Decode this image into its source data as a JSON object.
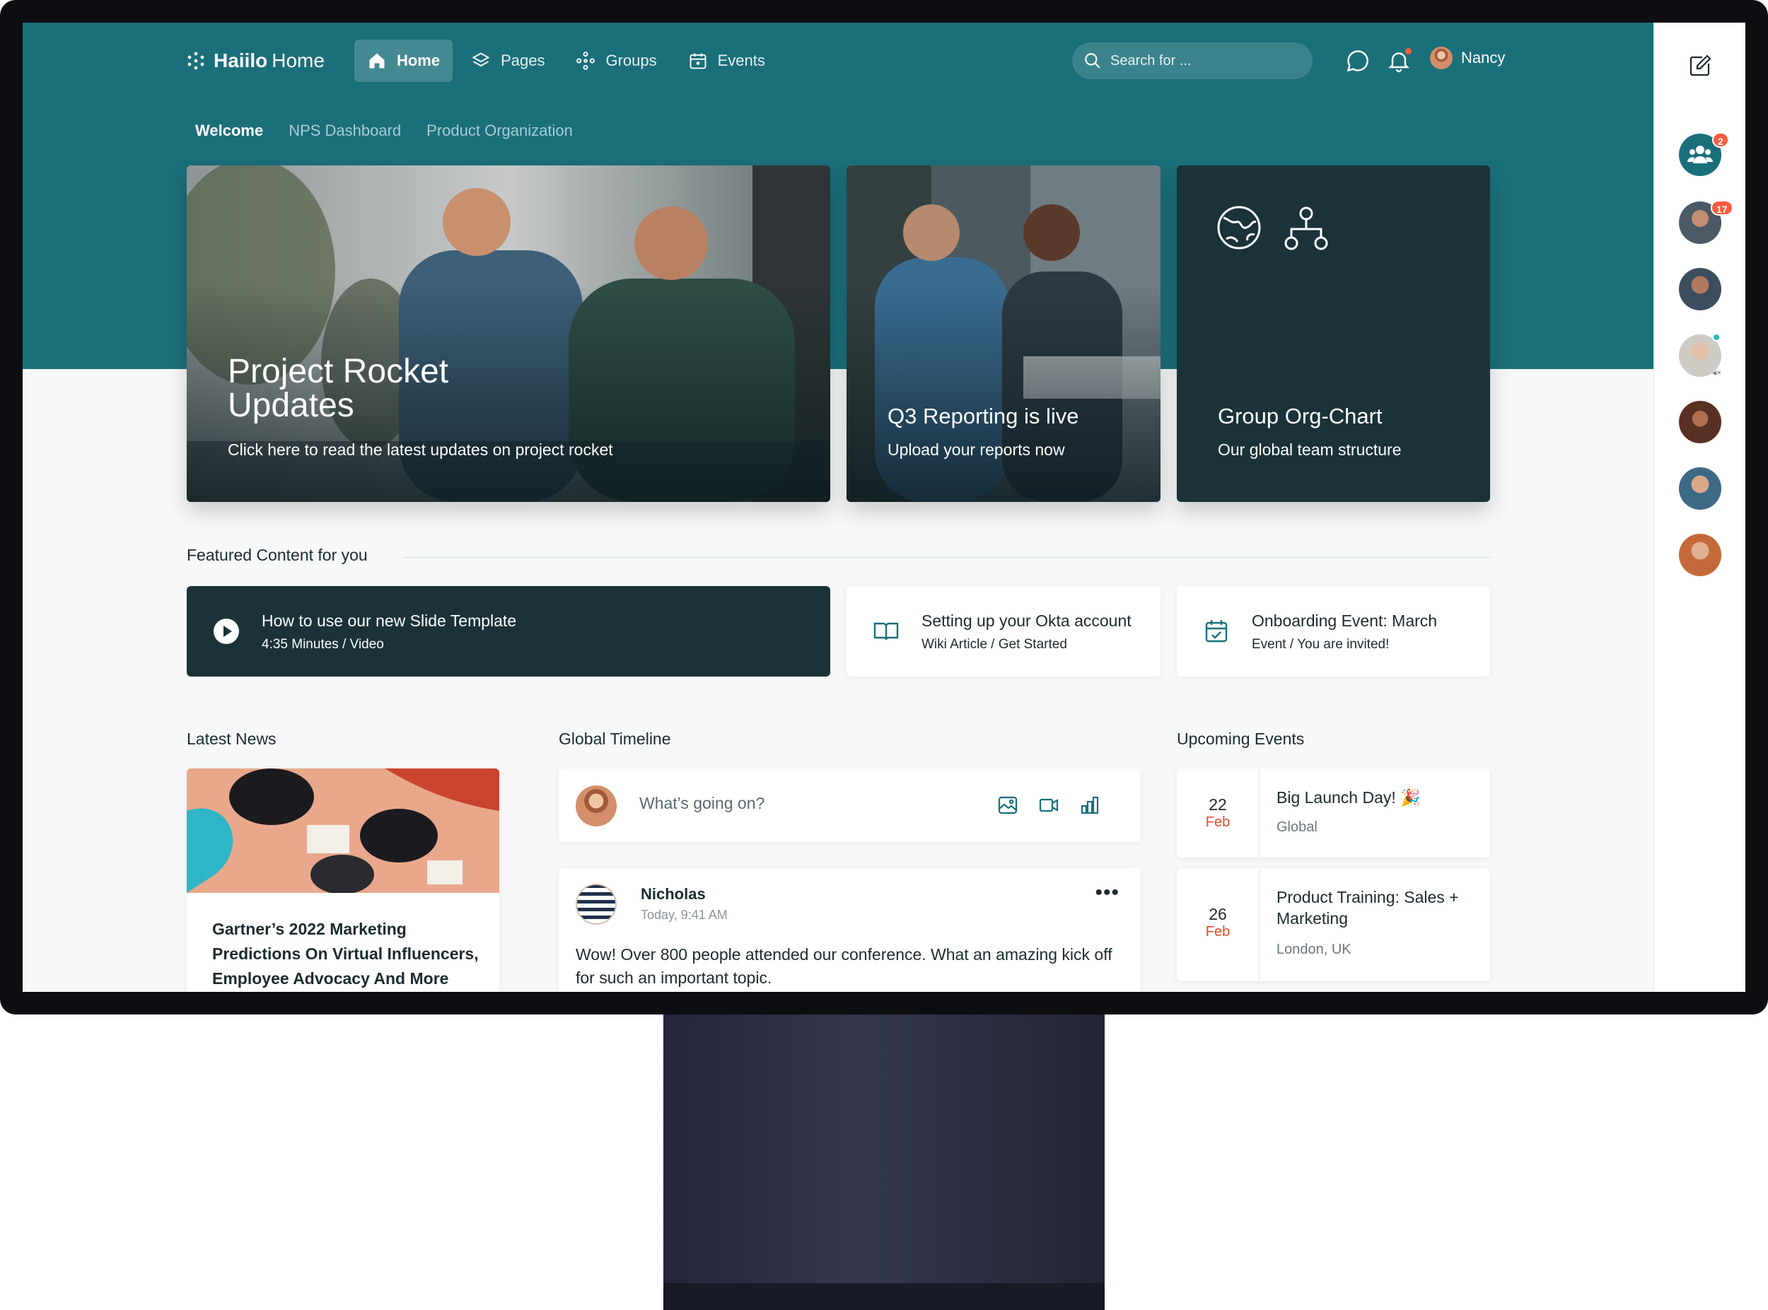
{
  "colors": {
    "brand": "#1b6f7a",
    "dark_card": "#1a3238",
    "accent_red": "#e8492b"
  },
  "nav": {
    "logo_bold": "Haiilo",
    "logo_light": "Home",
    "items": [
      {
        "label": "Home",
        "icon": "home-icon",
        "active": true
      },
      {
        "label": "Pages",
        "icon": "layers-icon"
      },
      {
        "label": "Groups",
        "icon": "groups-icon"
      },
      {
        "label": "Events",
        "icon": "calendar-icon"
      }
    ],
    "search_placeholder": "Search for ...",
    "user_name": "Nancy"
  },
  "subnav": [
    "Welcome",
    "NPS Dashboard",
    "Product Organization"
  ],
  "hero": {
    "main": {
      "title_line1": "Project Rocket",
      "title_line2": "Updates",
      "subtitle": "Click here to read the latest updates on project rocket"
    },
    "second": {
      "title": "Q3 Reporting is live",
      "subtitle": "Upload your reports now"
    },
    "third": {
      "title": "Group Org-Chart",
      "subtitle": "Our global team structure",
      "icons": [
        "globe-icon",
        "org-chart-icon"
      ]
    }
  },
  "featured": {
    "heading": "Featured Content for you",
    "items": [
      {
        "title": "How to use our new Slide Template",
        "meta": "4:35 Minutes / Video",
        "icon": "play-icon"
      },
      {
        "title": "Setting up your Okta account",
        "meta": "Wiki Article / Get Started",
        "icon": "book-icon"
      },
      {
        "title": "Onboarding Event: March",
        "meta": "Event / You are invited!",
        "icon": "calendar-check-icon"
      }
    ]
  },
  "news": {
    "heading": "Latest News",
    "article_title": "Gartner’s 2022 Marketing Predictions On Virtual Influencers, Employee Advocacy And More"
  },
  "timeline": {
    "heading": "Global Timeline",
    "compose_placeholder": "What’s going on?",
    "compose_icons": [
      "image-icon",
      "video-icon",
      "poll-icon"
    ],
    "post": {
      "author": "Nicholas",
      "time": "Today, 9:41 AM",
      "body": "Wow! Over 800 people attended our conference. What an amazing kick off for such an important topic."
    }
  },
  "events": {
    "heading": "Upcoming Events",
    "items": [
      {
        "day": "22",
        "month": "Feb",
        "title": "Big Launch Day! 🎉",
        "location": "Global"
      },
      {
        "day": "26",
        "month": "Feb",
        "title": "Product Training: Sales + Marketing",
        "location": "London, UK"
      }
    ]
  },
  "sidebar": {
    "badges": {
      "group_chat": "2",
      "contact_1": "17"
    }
  }
}
